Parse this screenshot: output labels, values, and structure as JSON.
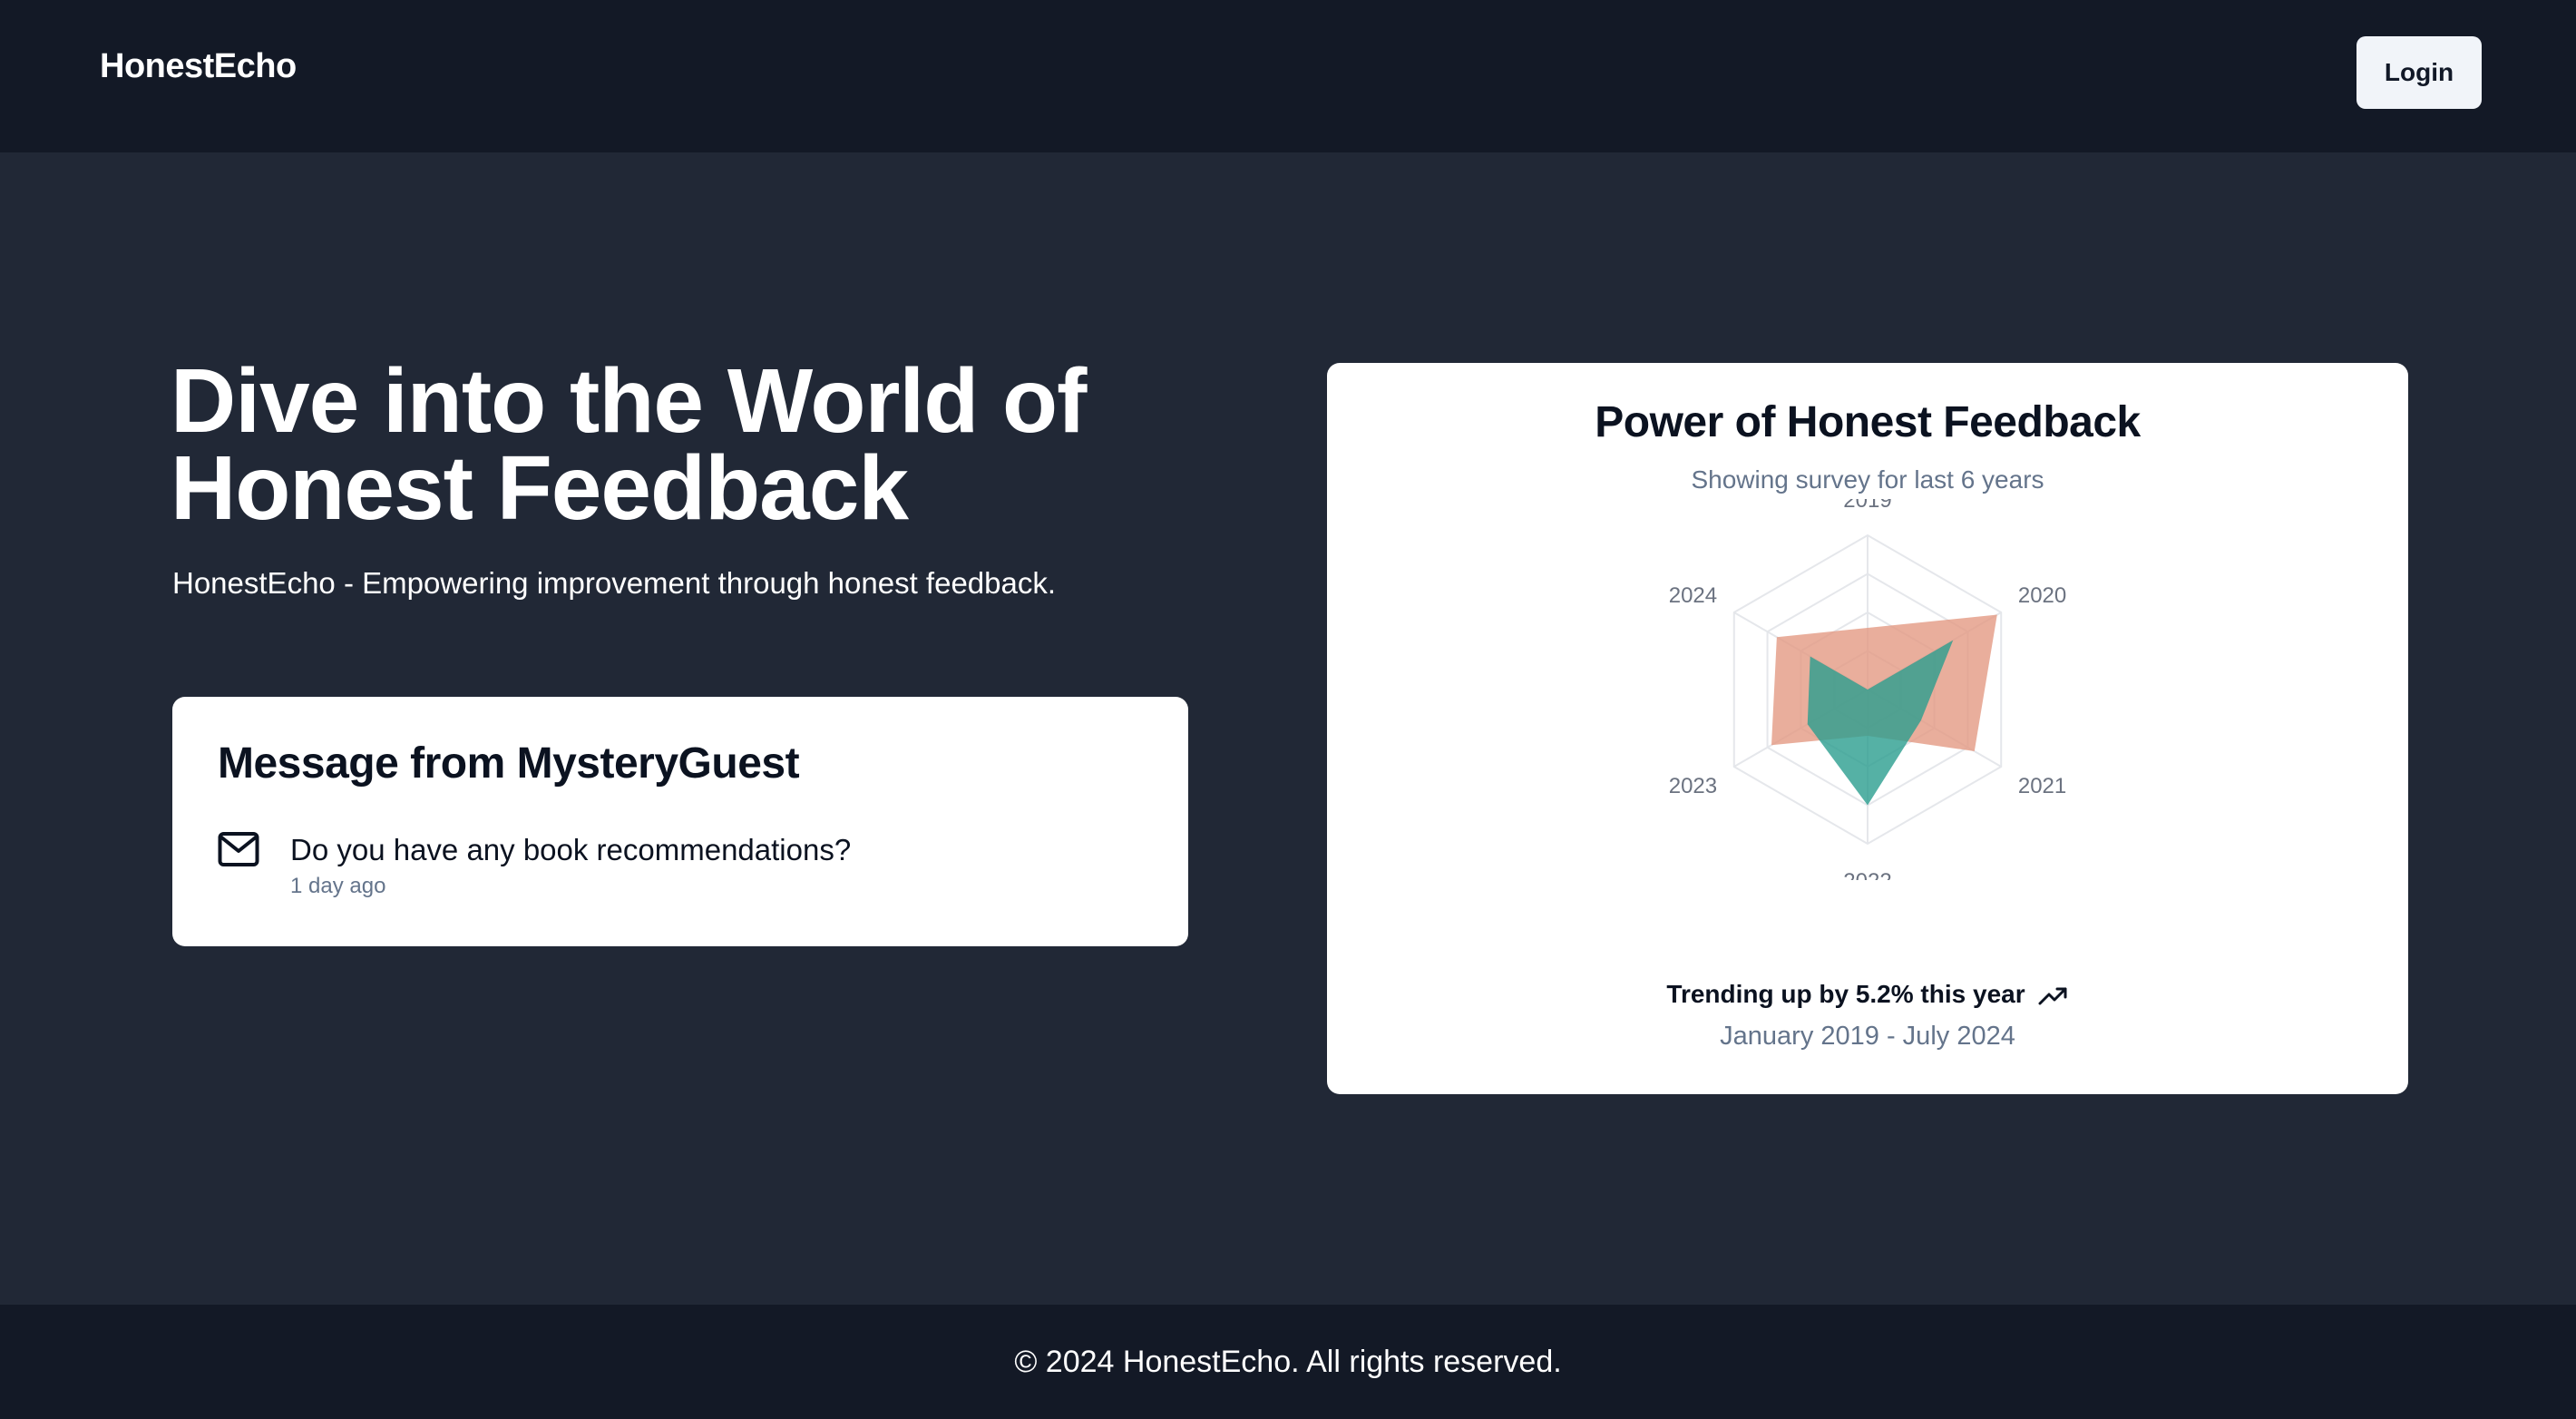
{
  "header": {
    "brand": "HonestEcho",
    "login_label": "Login"
  },
  "hero": {
    "title": "Dive into the World of Honest Feedback",
    "subtitle": "HonestEcho - Empowering improvement through honest feedback."
  },
  "message_card": {
    "title": "Message from MysteryGuest",
    "icon": "mail-icon",
    "text": "Do you have any book recommendations?",
    "time": "1 day ago"
  },
  "chart_card": {
    "title": "Power of Honest Feedback",
    "subtitle": "Showing survey for last 6 years",
    "trend_text": "Trending up by 5.2% this year",
    "trend_icon": "trending-up-icon",
    "period": "January 2019 - July 2024"
  },
  "chart_data": {
    "type": "radar",
    "categories": [
      "2019",
      "2020",
      "2021",
      "2022",
      "2023",
      "2024"
    ],
    "range": [
      0,
      100
    ],
    "grid": true,
    "series": [
      {
        "values": [
          40,
          97,
          80,
          30,
          72,
          68
        ],
        "color": "#e39a83",
        "opacity": 0.8
      },
      {
        "values": [
          0,
          64,
          40,
          75,
          45,
          43
        ],
        "color": "#2a9d8f",
        "opacity": 0.8
      }
    ]
  },
  "footer": {
    "text": "© 2024 HonestEcho. All rights reserved."
  }
}
